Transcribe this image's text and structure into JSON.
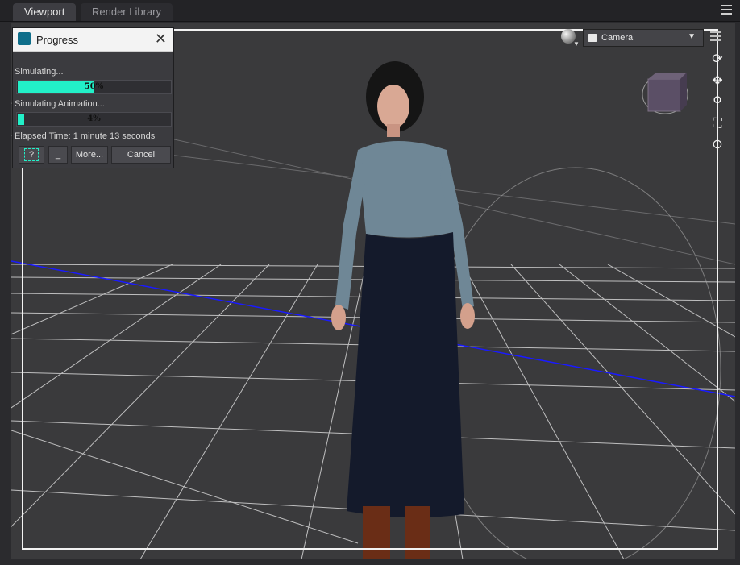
{
  "tabs": [
    {
      "label": "Viewport"
    },
    {
      "label": "Render Library"
    }
  ],
  "progress_dialog": {
    "title": "Progress",
    "simulating_label": "Simulating...",
    "simulating_progress": "50%",
    "simulating_fraction": 0.5,
    "animation_label": "Simulating Animation...",
    "animation_progress": "4%",
    "animation_fraction": 0.04,
    "elapsed": "Elapsed Time: 1 minute 13 seconds",
    "buttons": {
      "help": "?",
      "minimize": "_",
      "more": "More...",
      "cancel": "Cancel"
    }
  },
  "viewport": {
    "camera_label": "Camera"
  },
  "colors": {
    "progress_fill": "#22f0c8",
    "viewport_bg": "#3a3a3c",
    "horizon_line": "#1a1aff"
  },
  "icons": [
    "sphere-icon",
    "camera-icon",
    "menu-icon",
    "orbit-icon",
    "pan-icon",
    "zoom-icon",
    "frame-icon",
    "reset-icon"
  ]
}
